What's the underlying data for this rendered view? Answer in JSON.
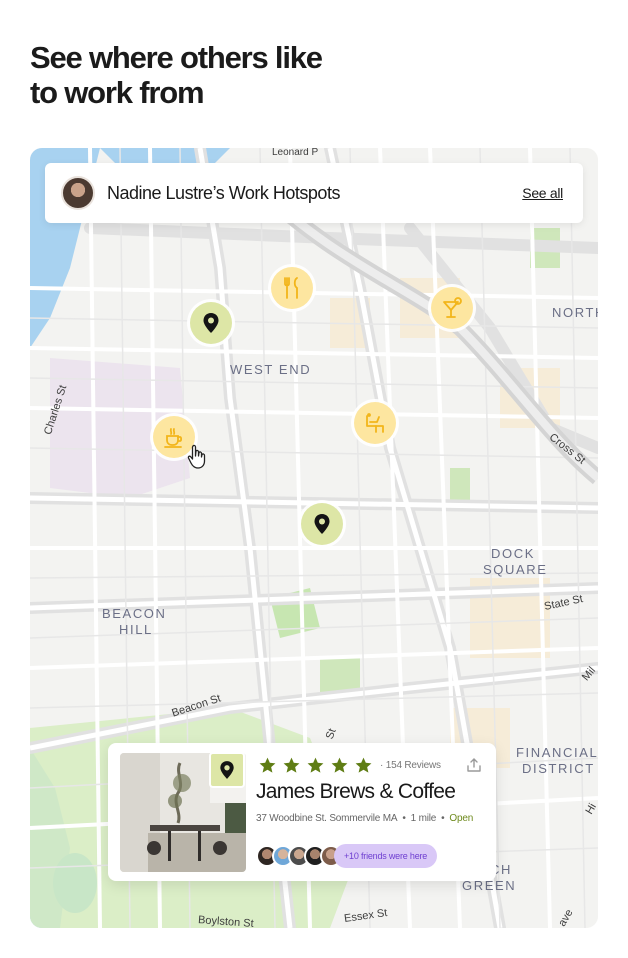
{
  "headline": {
    "line1": "See where others like",
    "line2": "to work from"
  },
  "hotspots": {
    "title": "Nadine Lustre’s Work Hotspots",
    "see_all": "See all"
  },
  "map": {
    "areas": {
      "west_end": "WEST END",
      "north": "NORTH",
      "beacon_hill_1": "BEACON",
      "beacon_hill_2": "HILL",
      "dock_square_1": "DOCK",
      "dock_square_2": "SQUARE",
      "financial_1": "FINANCIAL",
      "financial_2": "DISTRICT",
      "ch_green_1": "CH",
      "ch_green_2": "GREEN"
    },
    "streets": {
      "leonard": "Leonard P",
      "charles": "Charles St",
      "cross": "Cross St",
      "state": "State St",
      "beacon": "Beacon St",
      "milk": "Mil",
      "essex": "Essex St",
      "boylston": "Boylston St",
      "st": "St",
      "hi": "Hi",
      "ave": "ave"
    },
    "pins": [
      {
        "kind": "location",
        "icon": "location-pin-icon"
      },
      {
        "kind": "restaurant",
        "icon": "fork-knife-icon"
      },
      {
        "kind": "bar",
        "icon": "cocktail-icon"
      },
      {
        "kind": "cafe",
        "icon": "coffee-cup-icon"
      },
      {
        "kind": "workspace",
        "icon": "desk-chair-icon"
      },
      {
        "kind": "location",
        "icon": "location-pin-icon"
      }
    ]
  },
  "place": {
    "rating": 5,
    "reviews": "154 Reviews",
    "name": "James Brews & Coffee",
    "address": "37 Woodbine St. Sommervile MA",
    "distance": "1 mile",
    "status": "Open",
    "friends_badge": "+10 friends were here"
  },
  "colors": {
    "accent_green": "#dde6a6",
    "accent_yellow": "#fde6a0",
    "star_green": "#6e8a1d",
    "badge_purple": "#d9c8f7",
    "badge_text": "#6f3fd1"
  }
}
